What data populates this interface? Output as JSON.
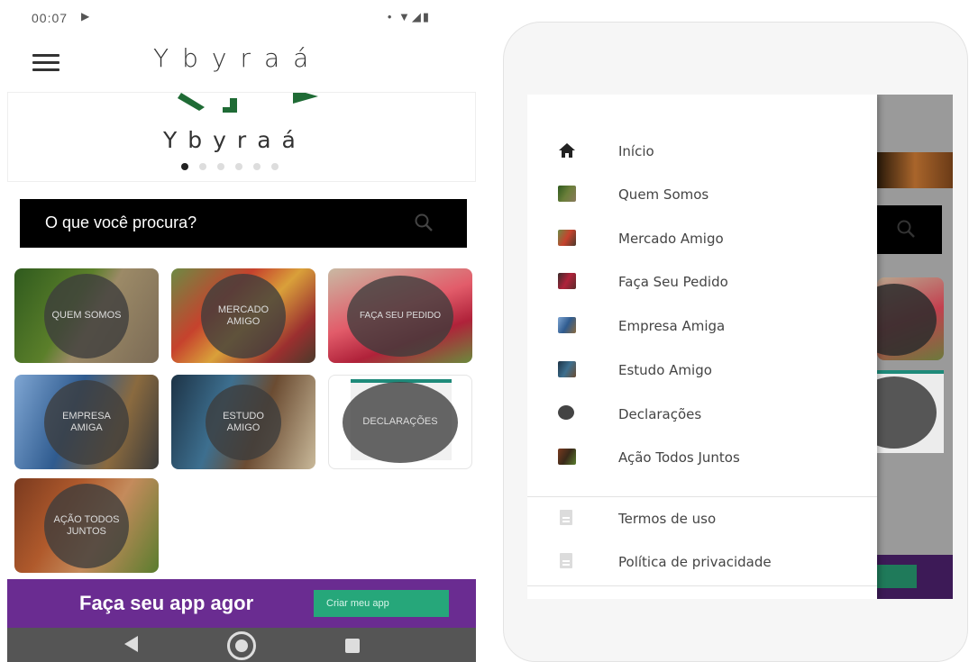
{
  "status_bar": {
    "time": "00:07",
    "play_glyph": "▶",
    "icons": "• ▼◢▮"
  },
  "app_bar": {
    "title": "Ybyraá",
    "menu_icon": "hamburger-icon"
  },
  "banner": {
    "title": "Ybyraá",
    "slide_count": 6,
    "active_slide": 1
  },
  "search": {
    "placeholder": "O que você procura?",
    "icon": "search-icon"
  },
  "tiles": [
    {
      "label": "QUEM SOMOS"
    },
    {
      "label": "MERCADO AMIGO"
    },
    {
      "label": "FAÇA SEU PEDIDO"
    },
    {
      "label": "EMPRESA AMIGA"
    },
    {
      "label": "ESTUDO AMIGO"
    },
    {
      "label": "DECLARAÇÕES"
    },
    {
      "label": "AÇÃO TODOS JUNTOS"
    }
  ],
  "promo": {
    "text": "Faça seu app agor",
    "button": "Criar meu app",
    "bg_color": "#6a2c91",
    "button_color": "#26a77a"
  },
  "drawer": {
    "items": [
      {
        "label": "Início",
        "icon": "home-icon"
      },
      {
        "label": "Quem Somos",
        "icon": "quem-somos-thumbnail-icon"
      },
      {
        "label": "Mercado Amigo",
        "icon": "mercado-amigo-thumbnail-icon"
      },
      {
        "label": "Faça Seu Pedido",
        "icon": "faca-seu-pedido-thumbnail-icon"
      },
      {
        "label": "Empresa Amiga",
        "icon": "empresa-amiga-thumbnail-icon"
      },
      {
        "label": "Estudo Amigo",
        "icon": "estudo-amigo-thumbnail-icon"
      },
      {
        "label": "Declarações",
        "icon": "declaracoes-thumbnail-icon"
      },
      {
        "label": "Ação Todos Juntos",
        "icon": "acao-todos-juntos-thumbnail-icon"
      }
    ],
    "footer_items": [
      {
        "label": "Termos de uso",
        "icon": "document-icon"
      },
      {
        "label": "Política de privacidade",
        "icon": "document-icon"
      }
    ]
  },
  "colors": {
    "brand_green": "#1f6b35",
    "purple": "#6a2c91",
    "teal": "#26a77a"
  }
}
